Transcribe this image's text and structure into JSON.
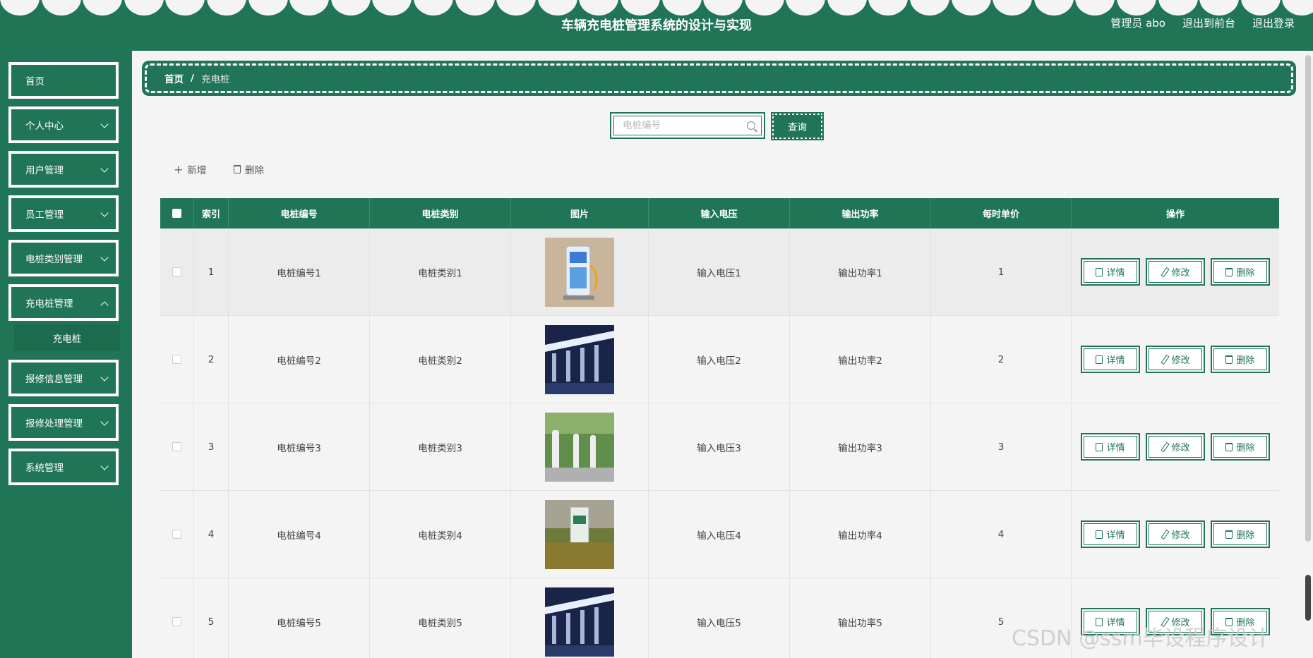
{
  "header": {
    "title": "车辆充电桩管理系统的设计与实现",
    "user": "管理员 abo",
    "back_front": "退出到前台",
    "logout": "退出登录"
  },
  "sidebar": {
    "items": [
      {
        "label": "首页",
        "expandable": false
      },
      {
        "label": "个人中心",
        "expandable": true
      },
      {
        "label": "用户管理",
        "expandable": true
      },
      {
        "label": "员工管理",
        "expandable": true
      },
      {
        "label": "电桩类别管理",
        "expandable": true
      },
      {
        "label": "充电桩管理",
        "expandable": true
      },
      {
        "label": "报修信息管理",
        "expandable": true
      },
      {
        "label": "报修处理管理",
        "expandable": true
      },
      {
        "label": "系统管理",
        "expandable": true
      }
    ],
    "submenu": {
      "label": "充电桩"
    }
  },
  "breadcrumb": {
    "home": "首页",
    "sep": "/",
    "current": "充电桩"
  },
  "search": {
    "placeholder": "电桩编号",
    "value": "",
    "button": "查询"
  },
  "actions": {
    "add": "新增",
    "delete": "删除"
  },
  "table": {
    "headers": [
      "索引",
      "电桩编号",
      "电桩类别",
      "图片",
      "输入电压",
      "输出功率",
      "每时单价",
      "操作"
    ],
    "rows": [
      {
        "index": "1",
        "code": "电桩编号1",
        "category": "电桩类别1",
        "image": "charging-station-photo-1",
        "voltage": "输入电压1",
        "power": "输出功率1",
        "price": "1"
      },
      {
        "index": "2",
        "code": "电桩编号2",
        "category": "电桩类别2",
        "image": "charging-station-photo-2",
        "voltage": "输入电压2",
        "power": "输出功率2",
        "price": "2"
      },
      {
        "index": "3",
        "code": "电桩编号3",
        "category": "电桩类别3",
        "image": "charging-station-photo-3",
        "voltage": "输入电压3",
        "power": "输出功率3",
        "price": "3"
      },
      {
        "index": "4",
        "code": "电桩编号4",
        "category": "电桩类别4",
        "image": "charging-station-photo-4",
        "voltage": "输入电压4",
        "power": "输出功率4",
        "price": "4"
      },
      {
        "index": "5",
        "code": "电桩编号5",
        "category": "电桩类别5",
        "image": "charging-station-photo-5",
        "voltage": "输入电压5",
        "power": "输出功率5",
        "price": "5"
      }
    ],
    "op_labels": {
      "detail": "详情",
      "edit": "修改",
      "delete": "删除"
    }
  },
  "watermark": "CSDN @ssm毕设程序设计",
  "colors": {
    "primary": "#207557",
    "background": "#f4f4f4"
  }
}
